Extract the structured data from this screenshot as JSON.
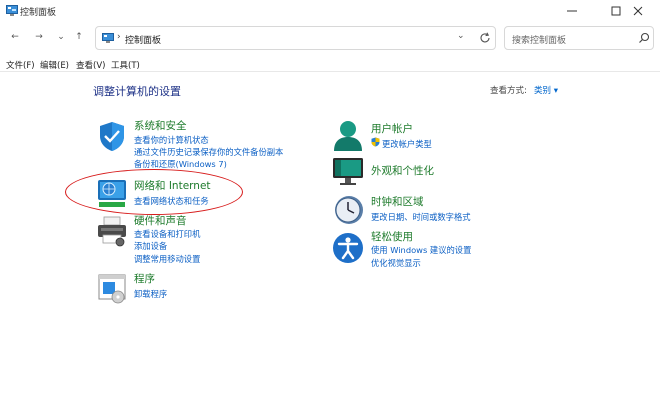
{
  "window": {
    "title": "控制面板"
  },
  "nav": {
    "back": "←",
    "forward": "→",
    "recent": "⌄",
    "up": "↑"
  },
  "address": {
    "separator": "›",
    "path": "控制面板",
    "dropdown": "⌄"
  },
  "search": {
    "placeholder": "搜索控制面板"
  },
  "menu": [
    "文件(F)",
    "编辑(E)",
    "查看(V)",
    "工具(T)"
  ],
  "heading": "调整计算机的设置",
  "view_by": {
    "label": "查看方式:",
    "value": "类别 ▾"
  },
  "left_categories": [
    {
      "title": "系统和安全",
      "icon": "shield-icon",
      "links": [
        "查看你的计算机状态",
        "通过文件历史记录保存你的文件备份副本",
        "备份和还原(Windows 7)"
      ]
    },
    {
      "title": "网络和 Internet",
      "icon": "network-globe-icon",
      "links": [
        "查看网络状态和任务"
      ]
    },
    {
      "title": "硬件和声音",
      "icon": "printer-icon",
      "links": [
        "查看设备和打印机",
        "添加设备",
        "调整常用移动设置"
      ]
    },
    {
      "title": "程序",
      "icon": "programs-icon",
      "links": [
        "卸载程序"
      ]
    }
  ],
  "right_categories": [
    {
      "title": "用户帐户",
      "icon": "user-icon",
      "links": [
        "更改帐户类型"
      ]
    },
    {
      "title": "外观和个性化",
      "icon": "monitor-icon",
      "links": []
    },
    {
      "title": "时钟和区域",
      "icon": "clock-icon",
      "links": [
        "更改日期、时间或数字格式"
      ]
    },
    {
      "title": "轻松使用",
      "icon": "accessibility-icon",
      "links": [
        "使用 Windows 建议的设置",
        "优化视觉显示"
      ]
    }
  ],
  "colors": {
    "category_title": "#1e7b2c",
    "link": "#0b5fc4",
    "heading": "#1e3287",
    "annotation": "#d71a1a"
  }
}
